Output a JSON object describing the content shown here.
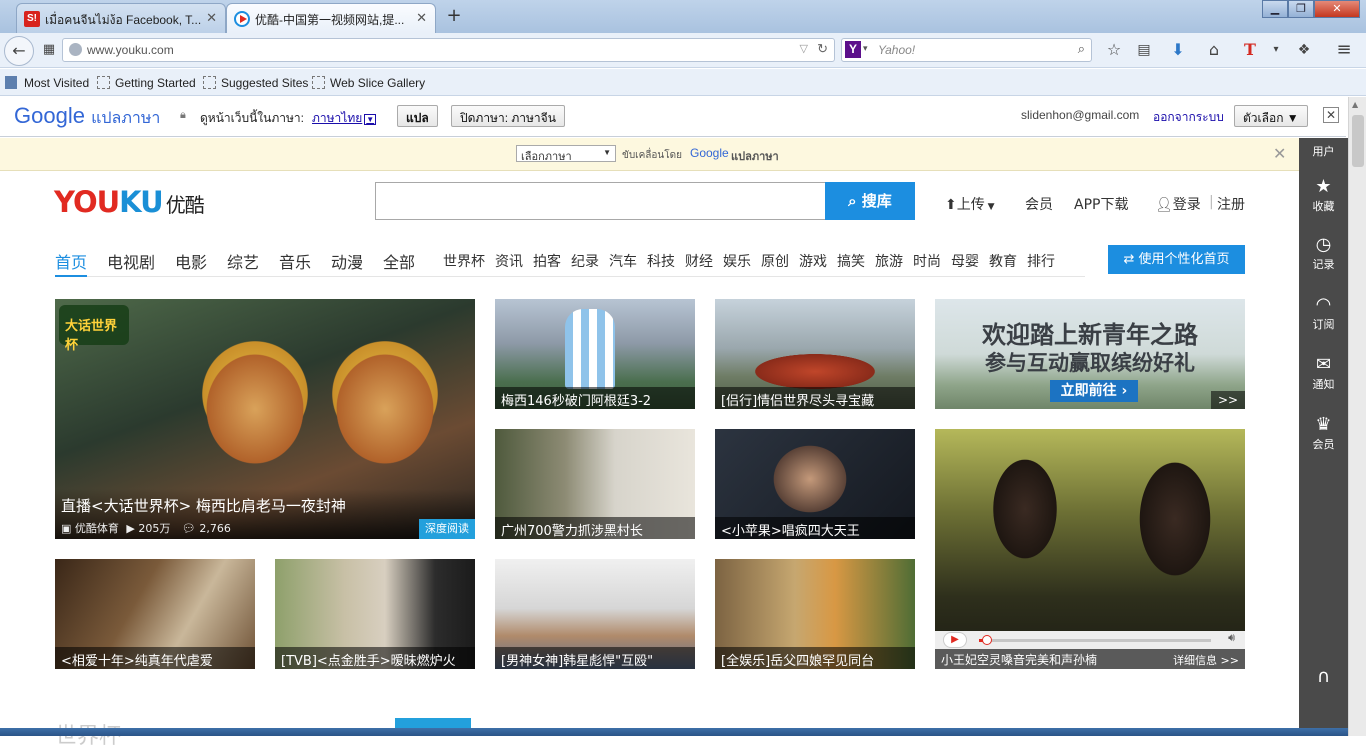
{
  "browser": {
    "tabs": [
      {
        "label": "เมื่อคนจีนไม่ง้อ Facebook, T...",
        "favicon": "sanook-icon",
        "fav_color": "#d8231d"
      },
      {
        "label": "优酷-中国第一视频网站,提...",
        "favicon": "youku-play-icon",
        "fav_color": "#1c8ee0"
      }
    ],
    "url": "www.youku.com",
    "search_placeholder": "Yahoo!",
    "bookmarks": [
      "Most Visited",
      "Getting Started",
      "Suggested Sites",
      "Web Slice Gallery"
    ]
  },
  "translate": {
    "brand": "Google",
    "brand_suffix": "แปลภาษา",
    "prompt": "ดูหน้าเว็บนี้ในภาษา:",
    "language": "ภาษาไทย",
    "translate_btn": "แปล",
    "off_btn": "ปิดภาษา: ภาษาจีน",
    "account": "slidenhon@gmail.com",
    "signout": "ออกจากระบบ",
    "options": "ตัวเลือก ▼",
    "select_language": "เลือกภาษา",
    "powered_by": "ขับเคลื่อนโดย",
    "powered_brand": "Google",
    "powered_suffix": "แปลภาษา"
  },
  "youku": {
    "logo_en_red": "YOU",
    "logo_en_blue": "KU",
    "logo_cn": "优酷",
    "search_btn": "搜库",
    "upload": "上传",
    "vip": "会员",
    "app": "APP下载",
    "login": "登录",
    "register": "注册",
    "main_cats": [
      "首页",
      "电视剧",
      "电影",
      "综艺",
      "音乐",
      "动漫",
      "全部"
    ],
    "sub_cats": [
      "世界杯",
      "资讯",
      "拍客",
      "纪录",
      "汽车",
      "科技",
      "财经",
      "娱乐",
      "原创",
      "游戏",
      "搞笑",
      "旅游",
      "时尚",
      "母婴",
      "教育",
      "排行"
    ],
    "personal_btn": "使用个性化首页",
    "featured": {
      "title": "直播<大话世界杯> 梅西比肩老马一夜封神",
      "channel": "优酷体育",
      "plays": "205万",
      "comments": "2,766",
      "badge": "深度阅读",
      "logo_text": "大话世界杯"
    },
    "tiles": [
      "梅西146秒破门阿根廷3-2",
      "[侣行]情侣世界尽头寻宝藏",
      "广州700警力抓涉黑村长",
      "<小苹果>唱疯四大天王",
      "<相爱十年>纯真年代虐爱",
      "[TVB]<点金胜手>暧昧燃炉火",
      "[男神女神]韩星彪悍\"互殴\"",
      "[全娱乐]岳父四娘罕见同台"
    ],
    "ad": {
      "line1": "欢迎踏上新青年之路",
      "line2": "参与互动赢取缤纷好礼",
      "btn": "立即前往",
      "more": ">>"
    },
    "video": {
      "caption": "小王妃空灵嗓音完美和声孙楠",
      "detail": "详细信息 >>",
      "progress": 0.02
    },
    "sidebar": [
      "用户",
      "收藏",
      "记录",
      "订阅",
      "通知",
      "会员"
    ],
    "bottom_heading": "世界杯"
  }
}
